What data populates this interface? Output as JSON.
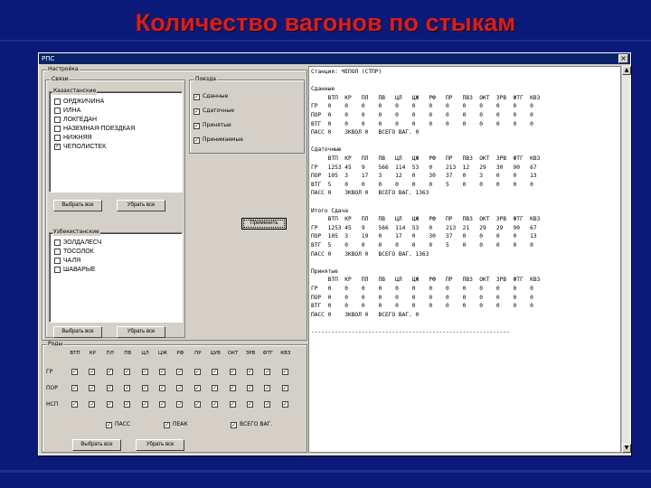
{
  "slide": {
    "title": "Количество вагонов по стыкам"
  },
  "window": {
    "title": "РПС",
    "close_glyph": "×"
  },
  "settings": {
    "group_label": "Настройка",
    "links_label": "Связи",
    "kazakhstan": {
      "label": "Казахстанские",
      "items": [
        {
          "label": "ОРДЖИЧИНА",
          "checked": false
        },
        {
          "label": "ИЛНА",
          "checked": false
        },
        {
          "label": "ЛОКГЕДАН",
          "checked": false
        },
        {
          "label": "НАЗЕМНАЯ-ПОЕЗДКАЯ",
          "checked": false
        },
        {
          "label": "НИЖНЯЯ",
          "checked": false
        },
        {
          "label": "ЧЕПОЛИСТЕК",
          "checked": true
        }
      ],
      "select_all": "Выбрать все",
      "clear_all": "Убрать все"
    },
    "uzbek": {
      "label": "Узбекистанские",
      "items": [
        {
          "label": "ЗОЛДАЛЕСЧ",
          "checked": false
        },
        {
          "label": "ТОСОЛОК",
          "checked": false
        },
        {
          "label": "ЧАЛЯ",
          "checked": false
        },
        {
          "label": "ШАВАРЫЕ",
          "checked": false
        }
      ],
      "select_all": "Выбрать все",
      "clear_all": "Убрать все"
    },
    "trains": {
      "label": "Поезда",
      "items": [
        {
          "label": "Сданные",
          "checked": true
        },
        {
          "label": "Сдаточные",
          "checked": true
        },
        {
          "label": "Принятые",
          "checked": true
        },
        {
          "label": "Принимаемые",
          "checked": true
        }
      ]
    },
    "apply": "Применить"
  },
  "types": {
    "label": "Роды",
    "columns": [
      "ВТП",
      "КР",
      "ПЛ",
      "ПВ",
      "ЦЛ",
      "ЦЖ",
      "РФ",
      "ПР",
      "ЦУВ",
      "ОКТ",
      "ЗРВ",
      "ФТГ",
      "КВЗ"
    ],
    "rows": [
      "ГР",
      "ПОР",
      "НСП"
    ],
    "options": [
      {
        "label": "ПАСС",
        "checked": true
      },
      {
        "label": "ПЕАК",
        "checked": true
      },
      {
        "label": "ВСЕГО ВАГ.",
        "checked": true
      }
    ],
    "select_all": "Выбрать все",
    "clear_all": "Убрать все"
  },
  "report": {
    "lines": [
      "Станция: ЧЕПОЛ (СТПР)",
      "",
      "Сданные",
      "     ВТП  КР   ПЛ   ПВ   ЦЛ   ЦЖ   РФ   ПР   ПВЗ  ОКТ  ЗРВ  ФТГ  КВЗ",
      "ГР   0    0    0    0    0    0    0    0    0    0    0    0    0",
      "ПОР  0    0    0    0    0    0    0    0    0    0    0    0    0",
      "ВТГ  0    0    0    0    0    0    0    0    0    0    0    0    0",
      "ПАСС 0    ЗКВОЛ 0   ВСЕГО ВАГ. 0",
      "",
      "Сдаточные",
      "     ВТП  КР   ПЛ   ПВ   ЦЛ   ЦЖ   РФ   ПР   ПВЗ  ОКТ  ЗРВ  ФТГ  КВЗ",
      "ГР   1253 45   9    566  114  53   0    213  12   29   30   90   67",
      "ПОР  105  3    17   3    12   0    30   37   0    3    0    0    13",
      "ВТГ  5    0    0    0    0    0    0    5    0    0    0    0    0",
      "ПАСС 0    ЗКВОЛ 0   ВСЕГО ВАГ. 1363",
      "",
      "Итого Сдача",
      "     ВТП  КР   ПЛ   ПВ   ЦЛ   ЦЖ   РФ   ПР   ПВЗ  ОКТ  ЗРВ  ФТГ  КВЗ",
      "ГР   1253 45   9    566  114  53   0    213  21   29   29   90   67",
      "ПОР  105  3    19   0    17   0    30   37   0    0    0    0    13",
      "ВТГ  5    0    0    0    0    0    0    5    0    0    0    0    0",
      "ПАСС 0    ЗКВОЛ 0   ВСЕГО ВАГ. 1363",
      "",
      "Принятые",
      "     ВТП  КР   ПЛ   ПВ   ЦЛ   ЦЖ   РФ   ПР   ПВЗ  ОКТ  ЗРВ  ФТГ  КВЗ",
      "ГР   0    0    0    0    0    0    0    0    0    0    0    0    0",
      "ПОР  0    0    0    0    0    0    0    0    0    0    0    0    0",
      "ВТГ  0    0    0    0    0    0    0    0    0    0    0    0    0",
      "ПАСС 0    ЗКВОЛ 0   ВСЕГО ВАГ. 0",
      "",
      "-----------------------------------------------------------"
    ]
  },
  "scroll": {
    "up": "▲",
    "down": "▼"
  },
  "colors": {
    "background": "#0b1a78",
    "title": "#d22020",
    "window_titlebar": "#0a246a"
  }
}
